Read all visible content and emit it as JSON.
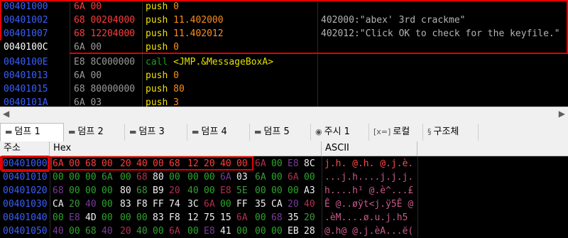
{
  "colors": {
    "address": "#3a5fff",
    "bytes": "#9a9a9a",
    "bytes_red": "#ff3b3b",
    "mnemonic": "#f0e000",
    "operand": "#ff8c1a",
    "call_mnemonic": "#1ea01e",
    "call_operand": "#e0e000",
    "comment": "#b4b4b4",
    "highlight": "#e30000"
  },
  "disasm": [
    {
      "addr": "00401000",
      "bytes": "6A 00",
      "mnemonic": "push",
      "operand": "0",
      "comment": "",
      "red": true
    },
    {
      "addr": "00401002",
      "bytes": "68 00204000",
      "mnemonic": "push",
      "operand": "11.402000",
      "comment": "402000:\"abex' 3rd crackme\"",
      "red": true
    },
    {
      "addr": "00401007",
      "bytes": "68 12204000",
      "mnemonic": "push",
      "operand": "11.402012",
      "comment": "402012:\"Click OK to check for the keyfile.\"",
      "red": true
    },
    {
      "addr": "0040100C",
      "bytes": "6A 00",
      "mnemonic": "push",
      "operand": "0",
      "comment": "",
      "red": false,
      "selected": true
    },
    {
      "addr": "0040100E",
      "bytes": "E8 8C000000",
      "mnemonic": "call",
      "operand": "<JMP.&MessageBoxA>",
      "comment": "",
      "red": false,
      "call": true
    },
    {
      "addr": "00401013",
      "bytes": "6A 00",
      "mnemonic": "push",
      "operand": "0",
      "comment": "",
      "red": false
    },
    {
      "addr": "00401015",
      "bytes": "68 80000000",
      "mnemonic": "push",
      "operand": "80",
      "comment": "",
      "red": false
    },
    {
      "addr": "0040101A",
      "bytes": "6A 03",
      "mnemonic": "push",
      "operand": "3",
      "comment": "",
      "red": false
    }
  ],
  "scrollbar": {
    "left": "◀",
    "right": "▶"
  },
  "tabs": [
    {
      "icon": "▬",
      "label": "덤프 1",
      "active": true
    },
    {
      "icon": "▬",
      "label": "덤프 2"
    },
    {
      "icon": "▬",
      "label": "덤프 3"
    },
    {
      "icon": "▬",
      "label": "덤프 4"
    },
    {
      "icon": "▬",
      "label": "덤프 5"
    },
    {
      "icon": "◉",
      "label": "주시 1"
    },
    {
      "icon": "[x=]",
      "label": "로컬"
    },
    {
      "icon": "§",
      "label": "구조체"
    }
  ],
  "dump_header": {
    "addr": "주소",
    "hex": "Hex",
    "ascii": "ASCII"
  },
  "dump": [
    {
      "addr": "00401000",
      "hex": [
        "6A",
        "00",
        "68",
        "00",
        "20",
        "40",
        "00",
        "68",
        "12",
        "20",
        "40",
        "00",
        "6A",
        "00",
        "E8",
        "8C"
      ],
      "ascii": "j.h. @.h. @.j.è.",
      "selected": true
    },
    {
      "addr": "00401010",
      "hex": [
        "00",
        "00",
        "00",
        "6A",
        "00",
        "68",
        "80",
        "00",
        "00",
        "00",
        "6A",
        "03",
        "6A",
        "00",
        "6A",
        "00"
      ],
      "ascii": "...j.h....j.j.j."
    },
    {
      "addr": "00401020",
      "hex": [
        "68",
        "00",
        "00",
        "00",
        "80",
        "68",
        "B9",
        "20",
        "40",
        "00",
        "E8",
        "5E",
        "00",
        "00",
        "00",
        "A3"
      ],
      "ascii": "h....h¹ @.è^...£"
    },
    {
      "addr": "00401030",
      "hex": [
        "CA",
        "20",
        "40",
        "00",
        "83",
        "F8",
        "FF",
        "74",
        "3C",
        "6A",
        "00",
        "FF",
        "35",
        "CA",
        "20",
        "40"
      ],
      "ascii": "Ê @..øÿt<j.ÿ5Ê @"
    },
    {
      "addr": "00401040",
      "hex": [
        "00",
        "E8",
        "4D",
        "00",
        "00",
        "00",
        "83",
        "F8",
        "12",
        "75",
        "15",
        "6A",
        "00",
        "68",
        "35",
        "20"
      ],
      "ascii": ".èM....ø.u.j.h5 "
    },
    {
      "addr": "00401050",
      "hex": [
        "40",
        "00",
        "68",
        "40",
        "20",
        "40",
        "00",
        "6A",
        "00",
        "E8",
        "41",
        "00",
        "00",
        "00",
        "EB",
        "28"
      ],
      "ascii": "@.h@ @.j.èA...ë("
    }
  ]
}
